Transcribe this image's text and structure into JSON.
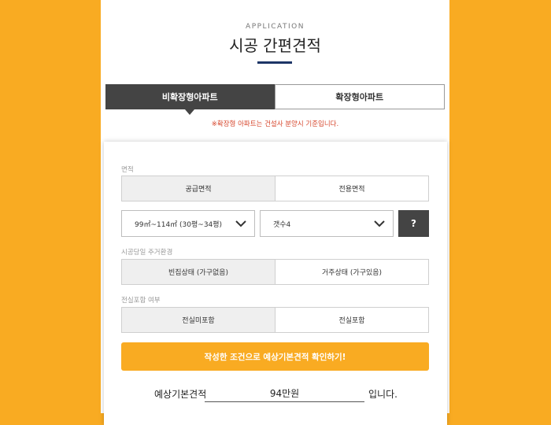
{
  "header": {
    "eyebrow": "APPLICATION",
    "title": "시공 간편견적"
  },
  "tabs": [
    {
      "label": "비확장형아파트",
      "active": true
    },
    {
      "label": "확장형아파트",
      "active": false
    }
  ],
  "notice": "※확장형 아파트는 건설사 분양시 기준입니다.",
  "form": {
    "area": {
      "label": "면적",
      "options": [
        "공급면적",
        "전용면적"
      ],
      "selected": 0
    },
    "size_select": {
      "value": "99㎡~114㎡ (30평~34평)"
    },
    "rooms_select": {
      "value": "갯수4"
    },
    "help_label": "?",
    "living": {
      "label": "시공당일 주거환경",
      "options": [
        "빈집상태 (가구없음)",
        "거주상태 (가구있음)"
      ],
      "selected": 0
    },
    "balcony": {
      "label": "전실포함 여부",
      "options": [
        "전실미포함",
        "전실포함"
      ],
      "selected": 0
    },
    "cta_label": "작성한 조건으로 예상기본견적 확인하기!"
  },
  "result": {
    "prefix": "예상기본견적",
    "value": "94만원",
    "suffix": "입니다."
  },
  "colors": {
    "accent": "#f9ab22",
    "dark": "#444444",
    "navy": "#1d3566",
    "notice": "#d6452b"
  },
  "icons": {
    "dropdown": "chevron-down-icon"
  }
}
